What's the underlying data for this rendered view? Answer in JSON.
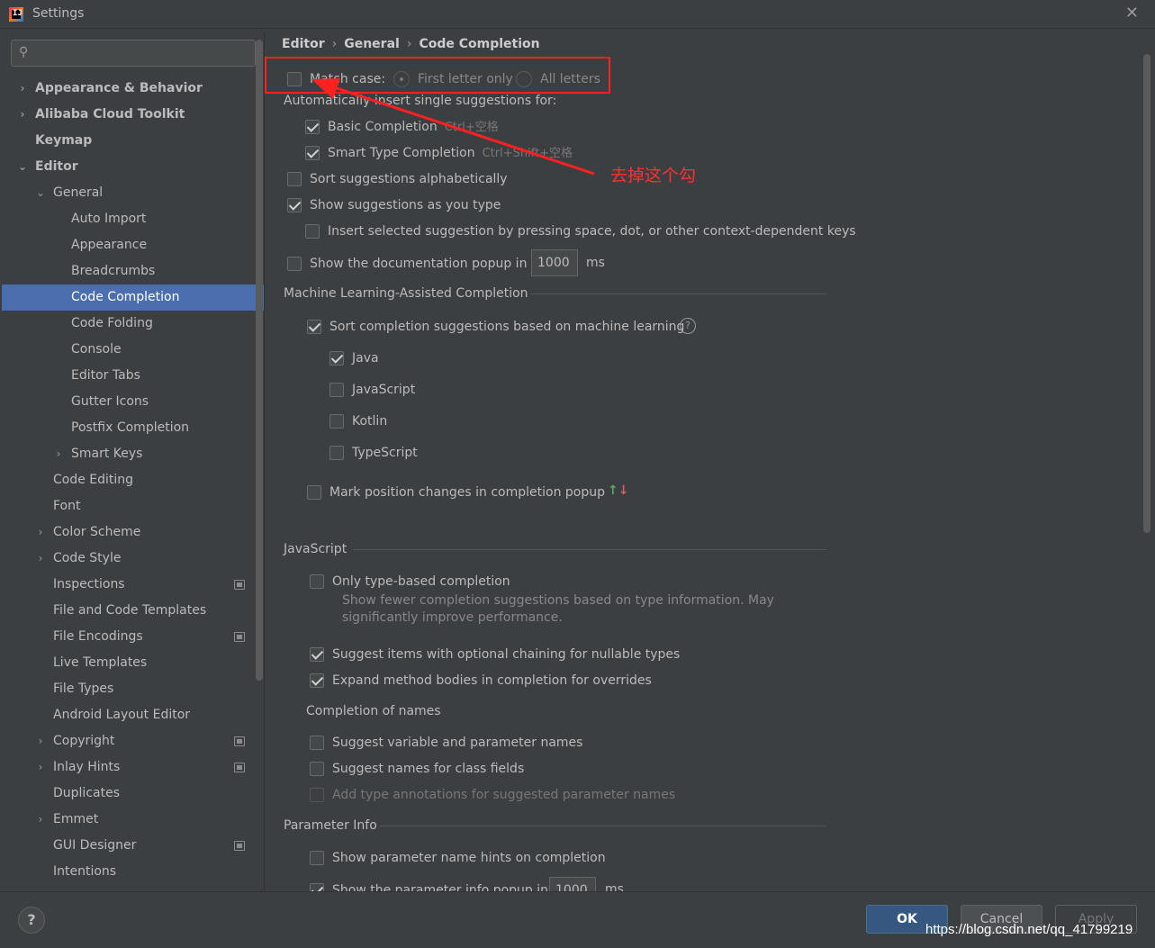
{
  "window": {
    "title": "Settings",
    "close_glyph": "✕",
    "app_icon_text": "IJ"
  },
  "search": {
    "placeholder": "",
    "icon": "search-icon",
    "glyph": "⚲"
  },
  "sidebar": {
    "items": [
      {
        "label": "Appearance & Behavior",
        "arrow": "›",
        "bold": true
      },
      {
        "label": "Alibaba Cloud Toolkit",
        "arrow": "›",
        "bold": true
      },
      {
        "label": "Keymap",
        "arrow": "",
        "bold": true
      },
      {
        "label": "Editor",
        "arrow": "⌄",
        "bold": true
      },
      {
        "label": "General",
        "arrow": "⌄"
      },
      {
        "label": "Auto Import",
        "arrow": ""
      },
      {
        "label": "Appearance",
        "arrow": ""
      },
      {
        "label": "Breadcrumbs",
        "arrow": ""
      },
      {
        "label": "Code Completion",
        "arrow": "",
        "selected": true
      },
      {
        "label": "Code Folding",
        "arrow": ""
      },
      {
        "label": "Console",
        "arrow": ""
      },
      {
        "label": "Editor Tabs",
        "arrow": ""
      },
      {
        "label": "Gutter Icons",
        "arrow": ""
      },
      {
        "label": "Postfix Completion",
        "arrow": ""
      },
      {
        "label": "Smart Keys",
        "arrow": "›"
      },
      {
        "label": "Code Editing",
        "arrow": ""
      },
      {
        "label": "Font",
        "arrow": ""
      },
      {
        "label": "Color Scheme",
        "arrow": "›"
      },
      {
        "label": "Code Style",
        "arrow": "›"
      },
      {
        "label": "Inspections",
        "arrow": "",
        "project": true
      },
      {
        "label": "File and Code Templates",
        "arrow": ""
      },
      {
        "label": "File Encodings",
        "arrow": "",
        "project": true
      },
      {
        "label": "Live Templates",
        "arrow": ""
      },
      {
        "label": "File Types",
        "arrow": ""
      },
      {
        "label": "Android Layout Editor",
        "arrow": ""
      },
      {
        "label": "Copyright",
        "arrow": "›",
        "project": true
      },
      {
        "label": "Inlay Hints",
        "arrow": "›",
        "project": true
      },
      {
        "label": "Duplicates",
        "arrow": ""
      },
      {
        "label": "Emmet",
        "arrow": "›"
      },
      {
        "label": "GUI Designer",
        "arrow": "",
        "project": true
      },
      {
        "label": "Intentions",
        "arrow": ""
      }
    ]
  },
  "breadcrumb": {
    "a": "Editor",
    "b": "General",
    "c": "Code Completion",
    "sep": "›"
  },
  "match_case": {
    "label": "Match case:",
    "checked": false,
    "opt1": "First letter only",
    "opt2": "All letters"
  },
  "auto_insert": {
    "title": "Automatically insert single suggestions for:",
    "basic": {
      "label": "Basic Completion",
      "shortcut": "Ctrl+空格",
      "checked": true
    },
    "smart": {
      "label": "Smart Type Completion",
      "shortcut": "Ctrl+Shift+空格",
      "checked": true
    }
  },
  "options": {
    "sort_alpha": {
      "label": "Sort suggestions alphabetically",
      "checked": false
    },
    "show_as_type": {
      "label": "Show suggestions as you type",
      "checked": true
    },
    "insert_selected": {
      "label": "Insert selected suggestion by pressing space, dot, or other context-dependent keys",
      "checked": false
    },
    "doc_popup": {
      "label": "Show the documentation popup in",
      "value": "1000",
      "unit": "ms",
      "checked": false
    }
  },
  "ml": {
    "title": "Machine Learning-Assisted Completion",
    "sort": {
      "label": "Sort completion suggestions based on machine learning",
      "checked": true,
      "help": "?"
    },
    "java": {
      "label": "Java",
      "checked": true
    },
    "javascript": {
      "label": "JavaScript",
      "checked": false
    },
    "kotlin": {
      "label": "Kotlin",
      "checked": false
    },
    "typescript": {
      "label": "TypeScript",
      "checked": false
    },
    "mark": {
      "label": "Mark position changes in completion popup",
      "checked": false,
      "up": "↑",
      "down": "↓"
    }
  },
  "js": {
    "title": "JavaScript",
    "type_based": {
      "label": "Only type-based completion",
      "checked": false,
      "desc": "Show fewer completion suggestions based on type information. May significantly improve performance."
    },
    "optional_chaining": {
      "label": "Suggest items with optional chaining for nullable types",
      "checked": true
    },
    "expand_method": {
      "label": "Expand method bodies in completion for overrides",
      "checked": true
    },
    "names_title": "Completion of names",
    "var_names": {
      "label": "Suggest variable and parameter names",
      "checked": false
    },
    "class_fields": {
      "label": "Suggest names for class fields",
      "checked": false
    },
    "type_annot": {
      "label": "Add type annotations for suggested parameter names",
      "checked": false
    }
  },
  "param_info": {
    "title": "Parameter Info",
    "hints": {
      "label": "Show parameter name hints on completion",
      "checked": false
    },
    "popup": {
      "label": "Show the parameter info popup in",
      "value": "1000",
      "unit": "ms",
      "checked": true
    }
  },
  "annotation": {
    "text": "去掉这个勾",
    "color": "#ff2020"
  },
  "footer": {
    "help": "?",
    "ok": "OK",
    "cancel": "Cancel",
    "apply": "Apply"
  },
  "watermark": "https://blog.csdn.net/qq_41799219",
  "colors": {
    "selection": "#4b6eaf",
    "background": "#3c3f41",
    "primary_button": "#365880"
  }
}
